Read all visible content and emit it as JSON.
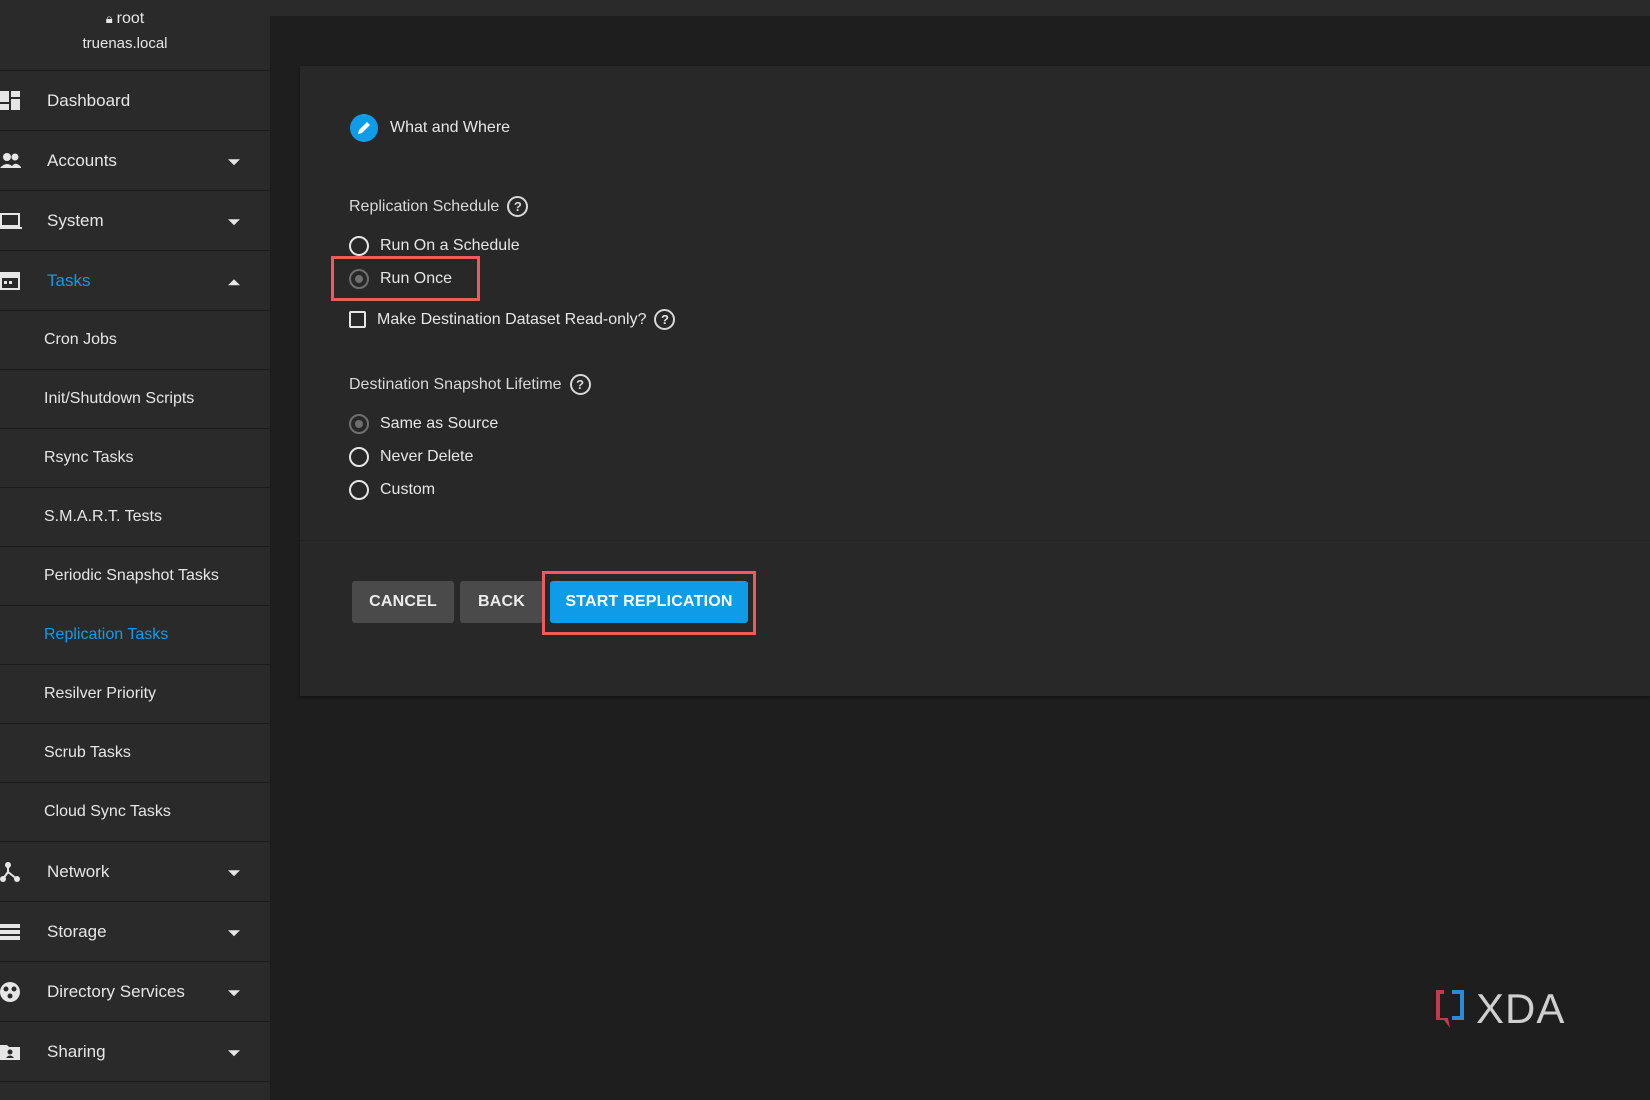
{
  "user": {
    "name": "root",
    "host": "truenas.local"
  },
  "sidebar": {
    "top_items": [
      {
        "label": "Dashboard",
        "icon": "dashboard-icon"
      },
      {
        "label": "Accounts",
        "icon": "accounts-icon"
      },
      {
        "label": "System",
        "icon": "system-icon"
      },
      {
        "label": "Tasks",
        "icon": "tasks-icon",
        "expanded": true,
        "active": true
      }
    ],
    "task_subitems": [
      "Cron Jobs",
      "Init/Shutdown Scripts",
      "Rsync Tasks",
      "S.M.A.R.T. Tests",
      "Periodic Snapshot Tasks",
      "Replication Tasks",
      "Resilver Priority",
      "Scrub Tasks",
      "Cloud Sync Tasks"
    ],
    "active_subitem": "Replication Tasks",
    "bottom_items": [
      {
        "label": "Network",
        "icon": "network-icon"
      },
      {
        "label": "Storage",
        "icon": "storage-icon"
      },
      {
        "label": "Directory Services",
        "icon": "directory-services-icon"
      },
      {
        "label": "Sharing",
        "icon": "sharing-icon"
      }
    ]
  },
  "wizard": {
    "step_label": "What and Where",
    "schedule": {
      "label": "Replication Schedule",
      "options": [
        "Run On a Schedule",
        "Run Once"
      ],
      "selected": "Run Once"
    },
    "readonly_checkbox": {
      "label": "Make Destination Dataset Read-only?",
      "checked": false
    },
    "lifetime": {
      "label": "Destination Snapshot Lifetime",
      "options": [
        "Same as Source",
        "Never Delete",
        "Custom"
      ],
      "selected": "Same as Source"
    },
    "buttons": {
      "cancel": "CANCEL",
      "back": "BACK",
      "start": "START REPLICATION"
    }
  },
  "watermark": "XDA",
  "colors": {
    "accent": "#0e9ce8",
    "highlight": "#ef5a5a",
    "sidebar_bg": "#2a2a2a",
    "page_bg": "#1e1e1e"
  }
}
